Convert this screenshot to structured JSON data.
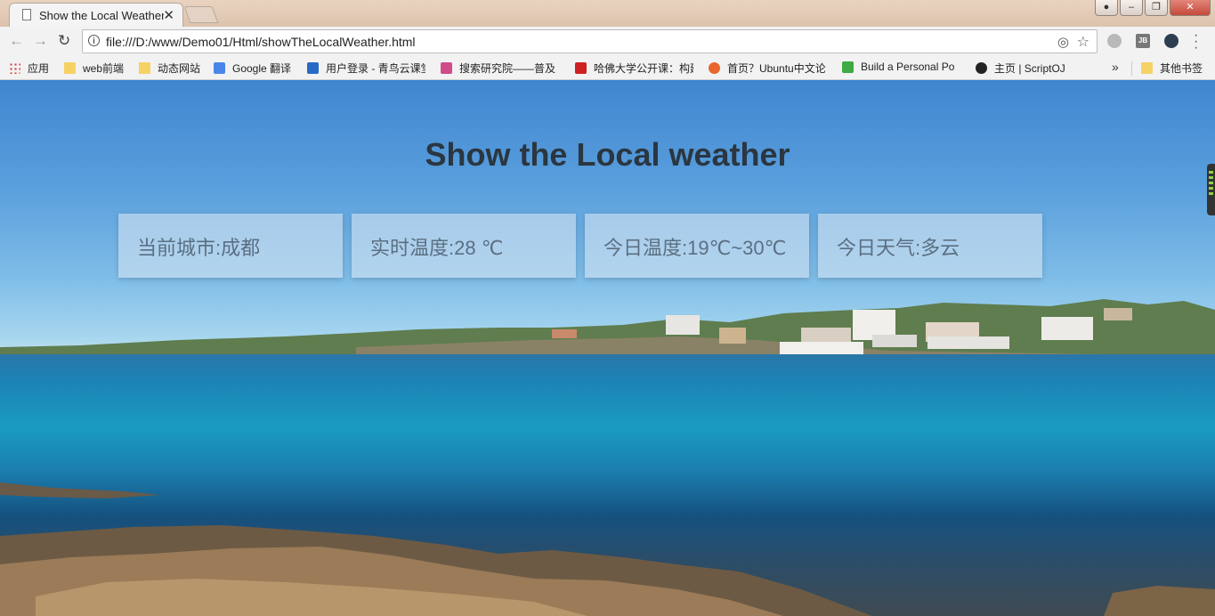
{
  "browser": {
    "tab_title": "Show the Local Weather",
    "url": "file:///D:/www/Demo01/Html/showTheLocalWeather.html",
    "extension_label_jb": "JB",
    "bookmarks": [
      {
        "label": "应用",
        "icon": "apps-icon"
      },
      {
        "label": "web前端",
        "icon": "folder-icon"
      },
      {
        "label": "动态网站",
        "icon": "folder-icon"
      },
      {
        "label": "Google 翻译",
        "icon": "google-translate-icon"
      },
      {
        "label": "用户登录 - 青鸟云课堂",
        "icon": "site-icon"
      },
      {
        "label": "搜索研究院——普及",
        "icon": "site-icon"
      },
      {
        "label": "哈佛大学公开课：构建",
        "icon": "site-icon"
      },
      {
        "label": "首页？Ubuntu中文论",
        "icon": "ubuntu-icon"
      },
      {
        "label": "Build a Personal Po",
        "icon": "site-icon"
      },
      {
        "label": "主页 | ScriptOJ",
        "icon": "github-icon"
      },
      {
        "label": "其他书签",
        "icon": "folder-icon"
      }
    ]
  },
  "page": {
    "title": "Show the Local weather",
    "cards": [
      {
        "text": "当前城市:成都"
      },
      {
        "text": "实时温度:28 ℃"
      },
      {
        "text": "今日温度:19℃~30℃"
      },
      {
        "text": "今日天气:多云"
      }
    ]
  }
}
